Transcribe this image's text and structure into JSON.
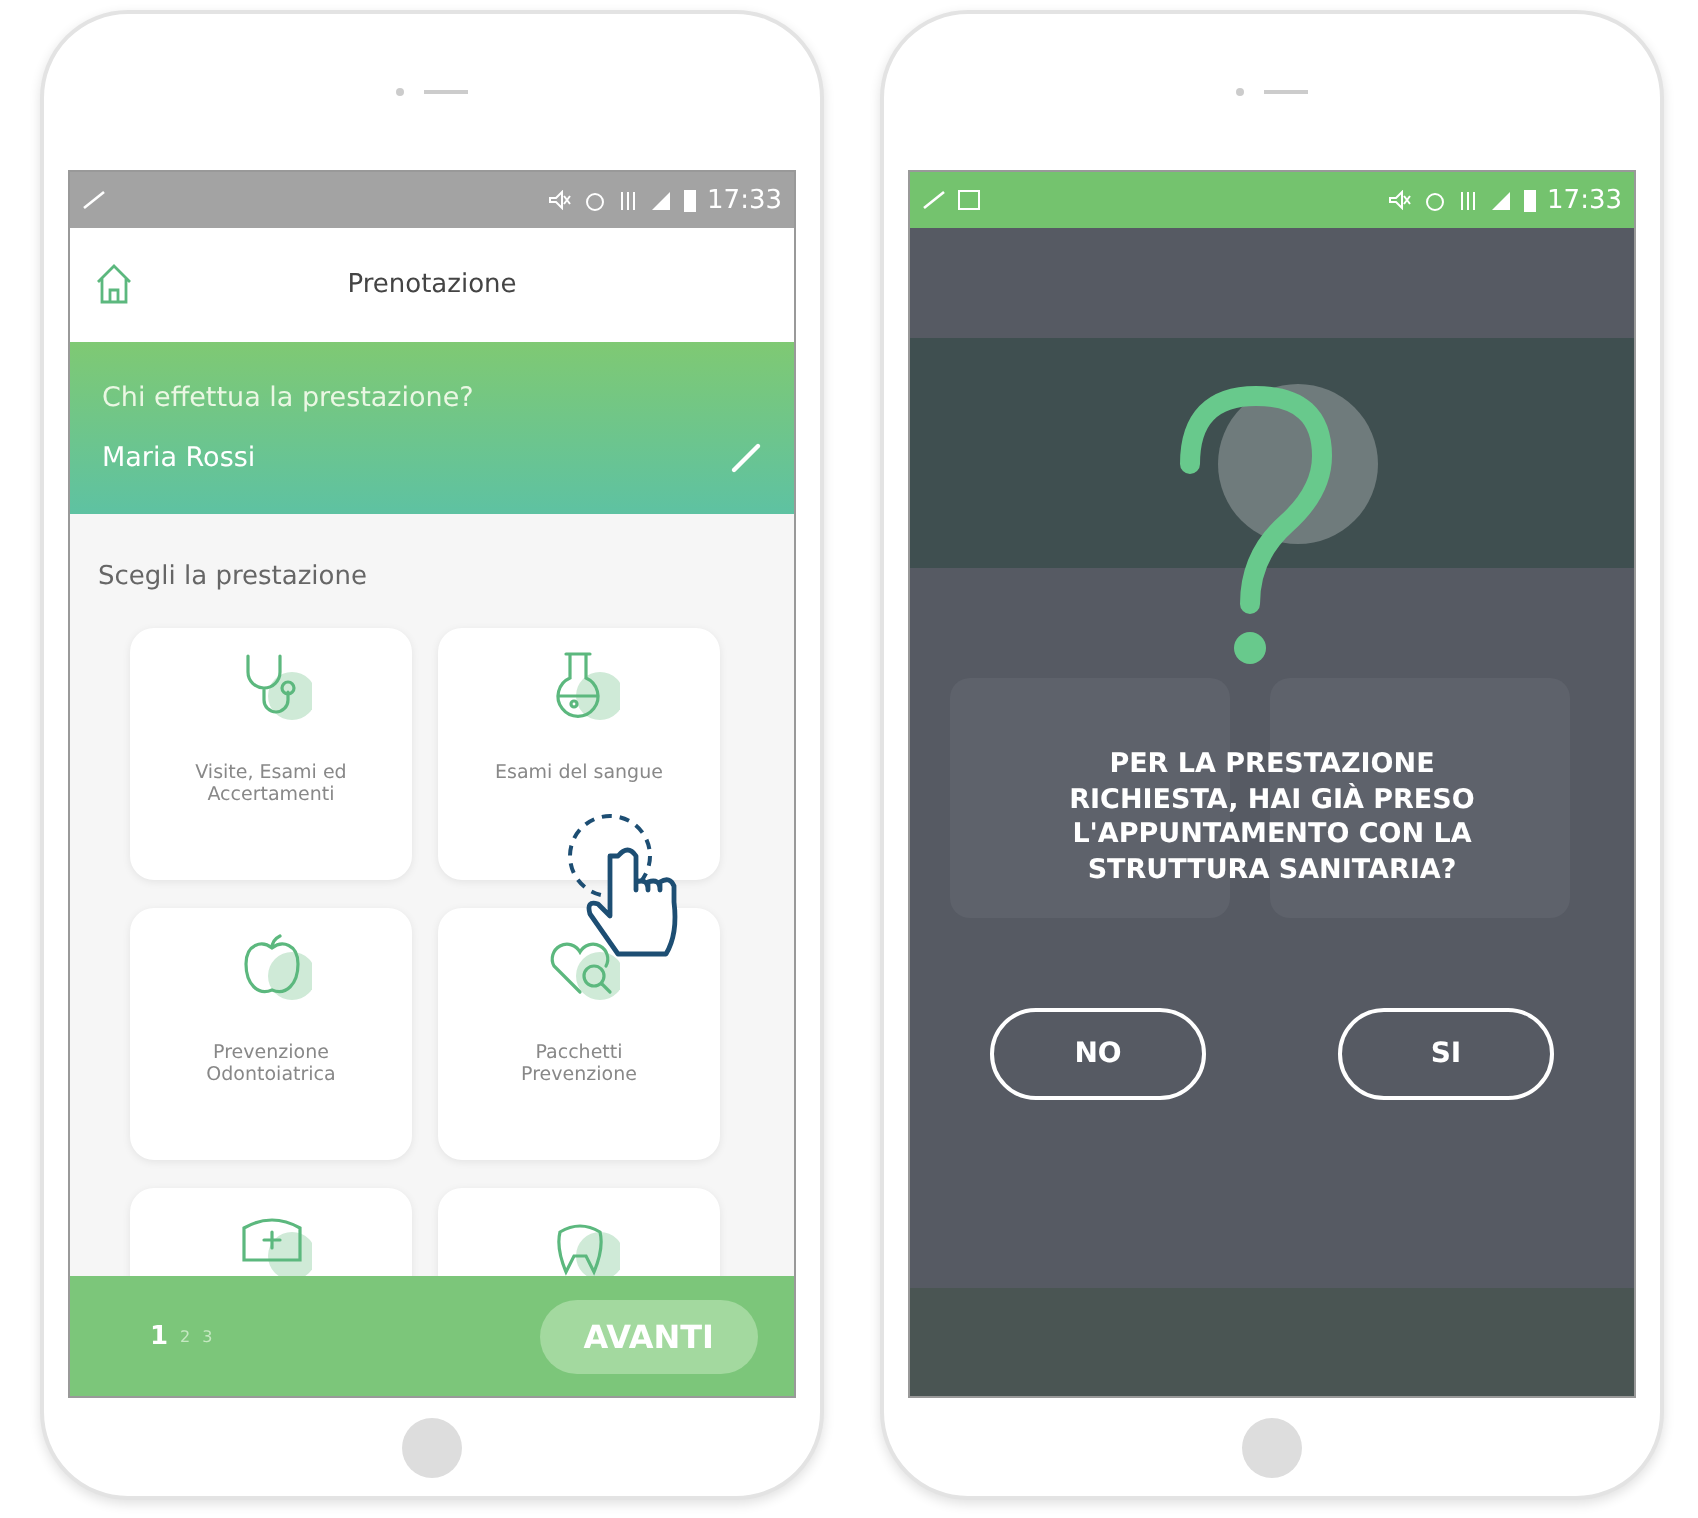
{
  "phones": [
    {
      "kind": "booking",
      "status_bar": {
        "time": "17:33"
      },
      "header": {
        "title": "Prenotazione"
      },
      "banner": {
        "question": "Chi effettua la prestazione?",
        "name": "Maria Rossi"
      },
      "section_title": "Scegli la prestazione",
      "tiles": [
        {
          "kind": "stethoscope",
          "label": "Visite, Esami ed Accertamenti"
        },
        {
          "kind": "flask",
          "label": "Esami del sangue"
        },
        {
          "kind": "apple",
          "label": "Prevenzione Odontoiatrica"
        },
        {
          "kind": "heart-search",
          "label": "Pacchetti Prevenzione"
        },
        {
          "kind": "nurse-cap"
        },
        {
          "kind": "tooth"
        }
      ],
      "pager": [
        {
          "label": "1",
          "selected": true
        },
        {
          "label": "2",
          "selected": false
        },
        {
          "label": "3",
          "selected": false
        }
      ],
      "next_button": "AVANTI"
    },
    {
      "kind": "dialog",
      "status_bar": {
        "time": "17:33"
      },
      "question": "PER LA PRESTAZIONE RICHIESTA, HAI GIÀ PRESO L'APPUNTAMENTO CON LA STRUTTURA SANITARIA?",
      "buttons": [
        "NO",
        "SI"
      ]
    }
  ]
}
